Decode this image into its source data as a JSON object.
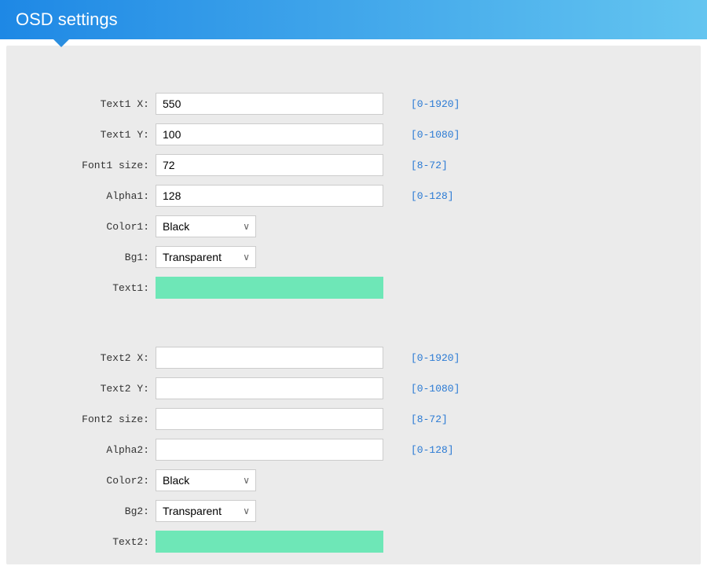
{
  "header": {
    "title": "OSD settings"
  },
  "group1": {
    "text_x": {
      "label": "Text1 X:",
      "value": "550",
      "hint": "[0-1920]"
    },
    "text_y": {
      "label": "Text1 Y:",
      "value": "100",
      "hint": "[0-1080]"
    },
    "font_size": {
      "label": "Font1 size:",
      "value": "72",
      "hint": "[8-72]"
    },
    "alpha": {
      "label": "Alpha1:",
      "value": "128",
      "hint": "[0-128]"
    },
    "color": {
      "label": "Color1:",
      "value": "Black"
    },
    "bg": {
      "label": "Bg1:",
      "value": "Transparent"
    },
    "text": {
      "label": "Text1:",
      "value": ""
    }
  },
  "group2": {
    "text_x": {
      "label": "Text2 X:",
      "value": "",
      "hint": "[0-1920]"
    },
    "text_y": {
      "label": "Text2 Y:",
      "value": "",
      "hint": "[0-1080]"
    },
    "font_size": {
      "label": "Font2 size:",
      "value": "",
      "hint": "[8-72]"
    },
    "alpha": {
      "label": "Alpha2:",
      "value": "",
      "hint": "[0-128]"
    },
    "color": {
      "label": "Color2:",
      "value": "Black"
    },
    "bg": {
      "label": "Bg2:",
      "value": "Transparent"
    },
    "text": {
      "label": "Text2:",
      "value": ""
    }
  }
}
